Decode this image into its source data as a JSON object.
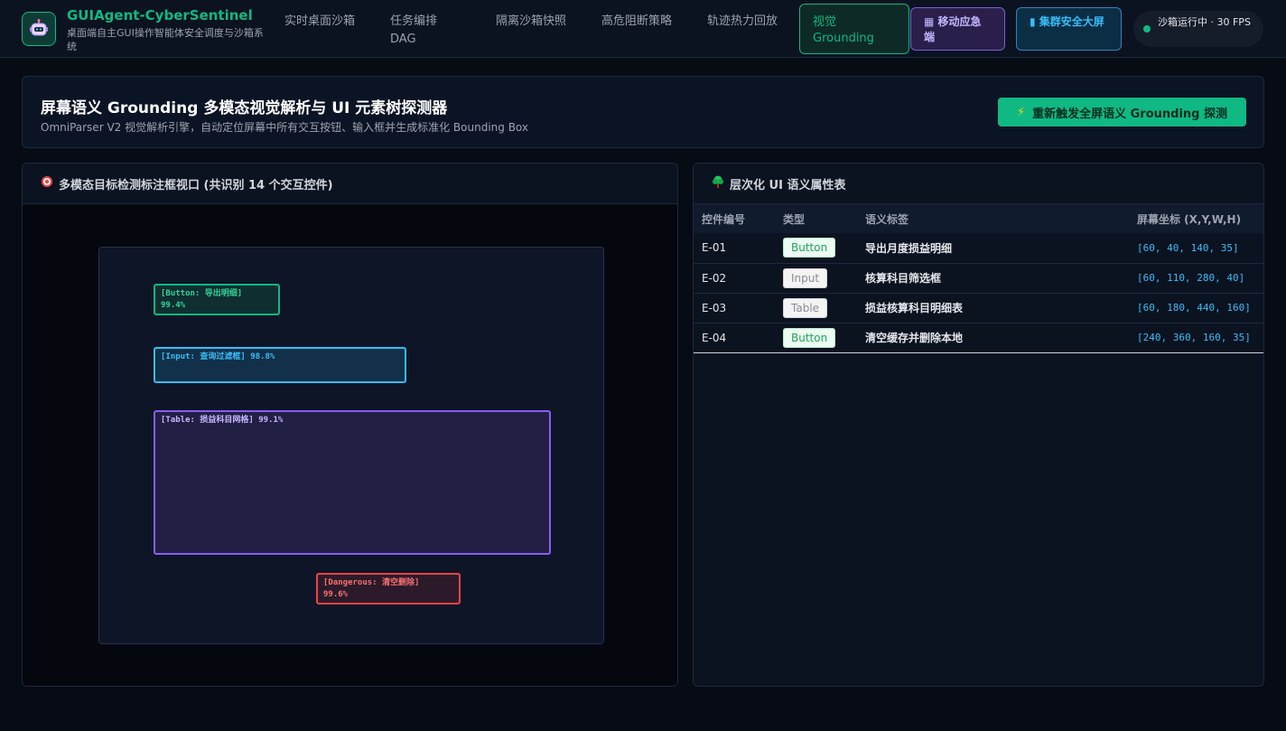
{
  "app": {
    "title": "GUIAgent-CyberSentinel",
    "subtitle": "桌面端自主GUI操作智能体安全调度与沙箱系统"
  },
  "nav": {
    "items": [
      {
        "label": "实时桌面沙箱"
      },
      {
        "label": "任务编排DAG"
      },
      {
        "label": "隔离沙箱快照"
      },
      {
        "label": "高危阻断策略"
      },
      {
        "label": "轨迹热力回放"
      },
      {
        "label": "视觉Grounding"
      }
    ],
    "active_index": 5,
    "mobile_icon": "mobile-calculator-icon",
    "mobile_label": "移动应急端",
    "cluster_icon": "bar-chart-icon",
    "cluster_label": "集群安全大屏",
    "status_text": "沙箱运行中 · 30 FPS"
  },
  "header": {
    "title": "屏幕语义 Grounding 多模态视觉解析与 UI 元素树探测器",
    "subtitle": "OmniParser V2 视觉解析引擎，自动定位屏幕中所有交互按钮、输入框并生成标准化 Bounding Box",
    "trigger_icon": "lightning-icon",
    "trigger_label": "重新触发全屏语义 Grounding 探测"
  },
  "detection": {
    "icon": "target-icon",
    "title": "多模态目标检测标注框视口 (共识别 14 个交互控件)",
    "boxes": [
      {
        "label": "[Button: 导出明细]",
        "score": "99.4%"
      },
      {
        "label": "[Input: 查询过滤框]",
        "score": "98.8%"
      },
      {
        "label": "[Table: 损益科目网格]",
        "score": "99.1%"
      },
      {
        "label": "[Dangerous: 清空删除]",
        "score": "99.6%"
      }
    ]
  },
  "tree": {
    "icon": "tree-icon",
    "title": "层次化 UI 语义属性表",
    "columns": [
      "控件编号",
      "类型",
      "语义标签",
      "屏幕坐标 (X,Y,W,H)"
    ],
    "rows": [
      {
        "id": "E-01",
        "type": "Button",
        "label": "导出月度损益明细",
        "coords": "[60, 40, 140, 35]"
      },
      {
        "id": "E-02",
        "type": "Input",
        "label": "核算科目筛选框",
        "coords": "[60, 110, 280, 40]"
      },
      {
        "id": "E-03",
        "type": "Table",
        "label": "损益核算科目明细表",
        "coords": "[60, 180, 440, 160]"
      },
      {
        "id": "E-04",
        "type": "Button",
        "label": "清空缓存并删除本地",
        "coords": "[240, 360, 160, 35]"
      }
    ]
  },
  "colors": {
    "accent": "#10b981",
    "info": "#38bdf8",
    "purple": "#8b5cf6",
    "danger": "#ef4444",
    "background": "#070b14"
  }
}
